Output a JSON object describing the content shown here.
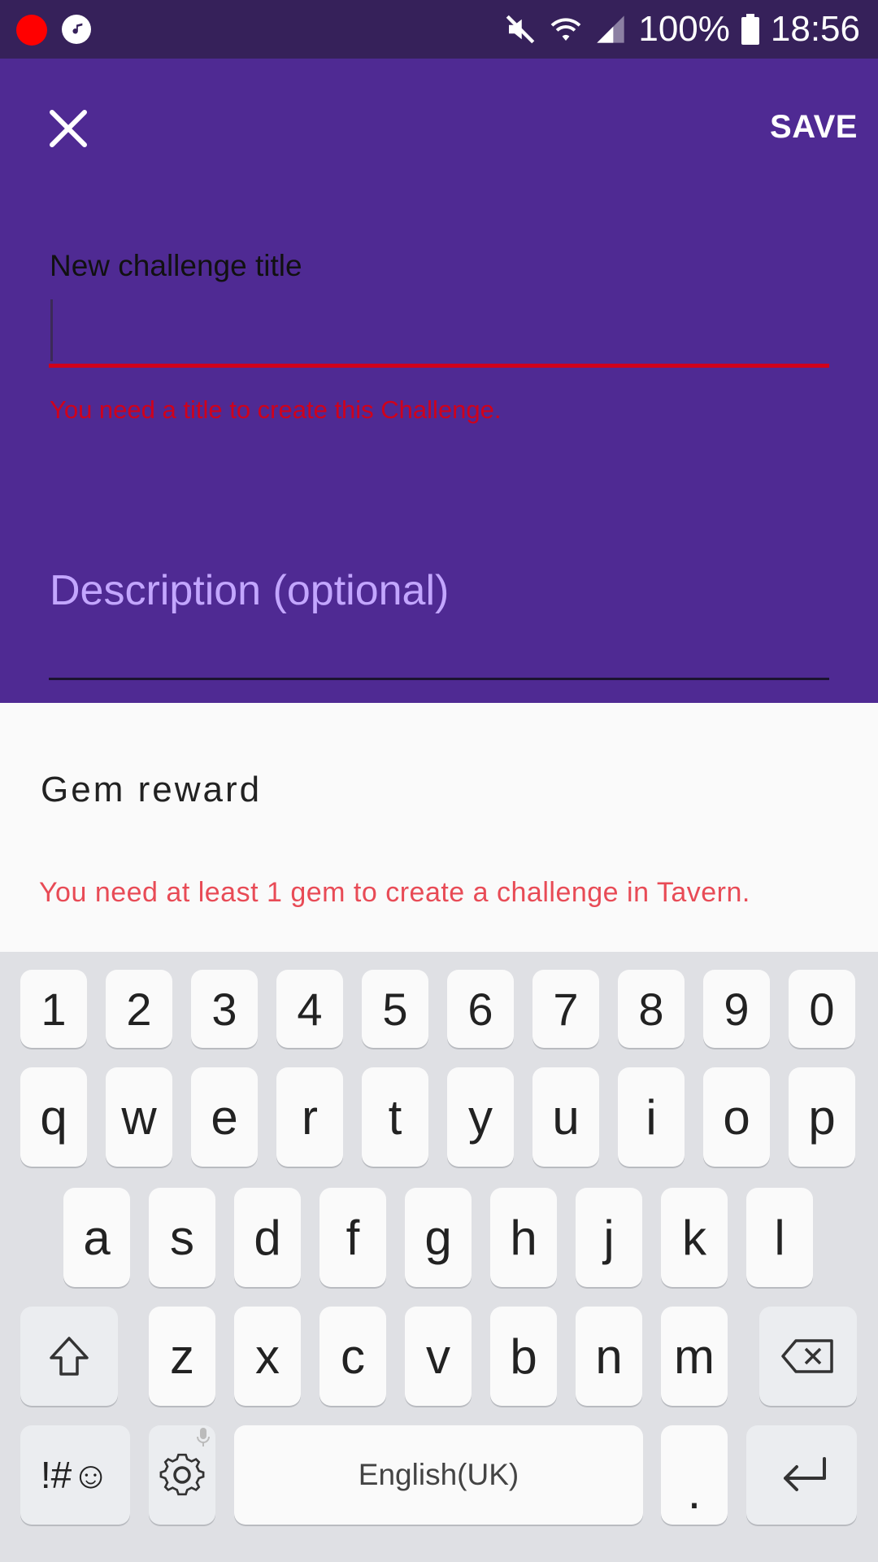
{
  "status_bar": {
    "battery": "100%",
    "time": "18:56",
    "icons": [
      "record-icon",
      "music-icon",
      "mute-icon",
      "wifi-icon",
      "signal-icon",
      "battery-icon"
    ]
  },
  "toolbar": {
    "close_icon": "close-icon",
    "save_label": "SAVE"
  },
  "form": {
    "title_label": "New challenge title",
    "title_value": "",
    "title_error": "You need a title to create this Challenge.",
    "description_placeholder": "Description (optional)"
  },
  "gem": {
    "title": "Gem reward",
    "error": "You need at least 1 gem to create a challenge in Tavern."
  },
  "keyboard": {
    "numbers": [
      "1",
      "2",
      "3",
      "4",
      "5",
      "6",
      "7",
      "8",
      "9",
      "0"
    ],
    "row1": [
      "q",
      "w",
      "e",
      "r",
      "t",
      "y",
      "u",
      "i",
      "o",
      "p"
    ],
    "row2": [
      "a",
      "s",
      "d",
      "f",
      "g",
      "h",
      "j",
      "k",
      "l"
    ],
    "row3": [
      "z",
      "x",
      "c",
      "v",
      "b",
      "n",
      "m"
    ],
    "symbols_label": "!#☺",
    "space_label": "English(UK)",
    "period_label": "."
  },
  "colors": {
    "primary": "#4f2a93",
    "statusbar": "#36215a",
    "error": "#d0021b",
    "hint": "#c3a6ff"
  }
}
